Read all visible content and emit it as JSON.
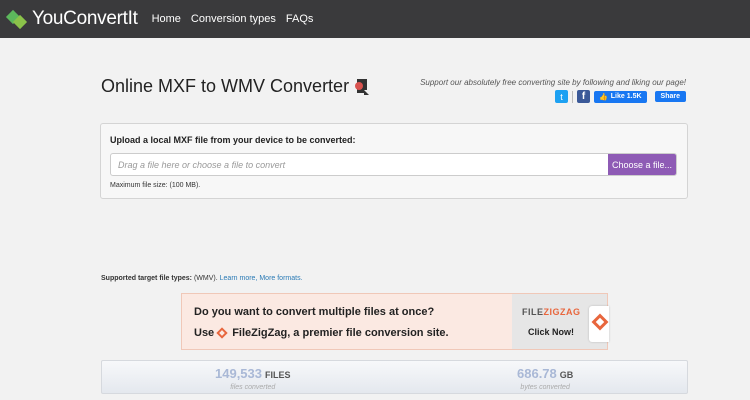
{
  "nav": {
    "brand": "YouConvertIt",
    "links": [
      "Home",
      "Conversion types",
      "FAQs"
    ]
  },
  "header": {
    "title": "Online MXF to WMV Converter",
    "support_text": "Support our absolutely free converting site by following and liking our page!",
    "fb_like_label": "Like 1.5K",
    "fb_share_label": "Share"
  },
  "upload": {
    "label": "Upload a local MXF file from your device to be converted:",
    "placeholder": "Drag a file here or choose a file to convert",
    "choose_button": "Choose a file...",
    "max_size": "Maximum file size: (100 MB)."
  },
  "supported": {
    "label": "Supported target file types:",
    "types": "(WMV).",
    "learn_more": "Learn more,",
    "more_formats": "More formats."
  },
  "banner": {
    "question": "Do you want to convert multiple files at once?",
    "use_prefix": "Use",
    "use_text": "FileZigZag, a premier file conversion site.",
    "logo_file": "FILE",
    "logo_zigzag": "ZIGZAG",
    "click_now": "Click Now!"
  },
  "stats": {
    "files_value": "149,533",
    "files_unit": "FILES",
    "files_sub": "files converted",
    "bytes_value": "686.78",
    "bytes_unit": "GB",
    "bytes_sub": "bytes converted"
  },
  "colors": {
    "navbar": "#3a3a3c",
    "accent_button": "#8e5bb5",
    "banner_bg": "#fbe9e2",
    "filezigzag_orange": "#e8663d"
  }
}
